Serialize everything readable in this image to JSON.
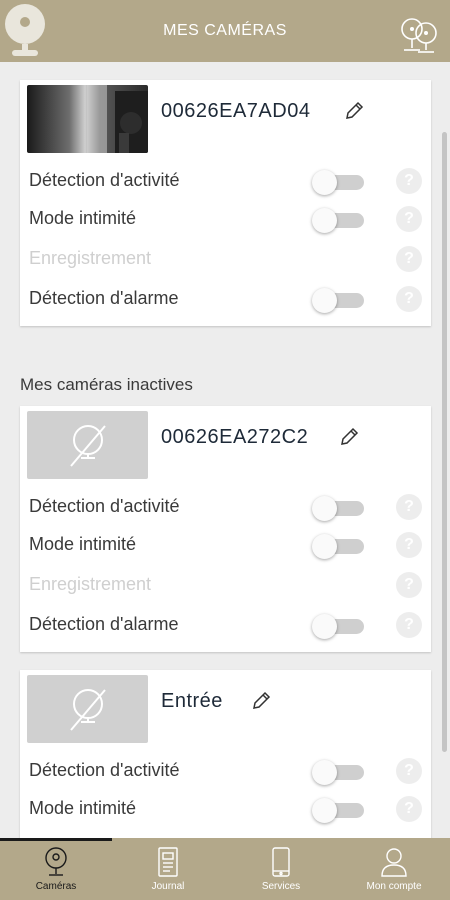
{
  "header": {
    "title": "MES CAMÉRAS"
  },
  "cameras_active": [
    {
      "name": "00626EA7AD04",
      "rows": [
        {
          "label": "Détection d'activité",
          "enabled": true
        },
        {
          "label": "Mode intimité",
          "enabled": true
        },
        {
          "label": "Enregistrement",
          "enabled": false
        },
        {
          "label": "Détection d'alarme",
          "enabled": true
        }
      ]
    }
  ],
  "inactive_section_title": "Mes caméras inactives",
  "cameras_inactive": [
    {
      "name": "00626EA272C2",
      "rows": [
        {
          "label": "Détection d'activité",
          "enabled": true
        },
        {
          "label": "Mode intimité",
          "enabled": true
        },
        {
          "label": "Enregistrement",
          "enabled": false
        },
        {
          "label": "Détection d'alarme",
          "enabled": true
        }
      ]
    },
    {
      "name": "Entrée",
      "rows": [
        {
          "label": "Détection d'activité",
          "enabled": true
        },
        {
          "label": "Mode intimité",
          "enabled": true
        }
      ]
    }
  ],
  "help_glyph": "?",
  "tabs": [
    {
      "label": "Caméras",
      "icon": "camera-icon",
      "active": true
    },
    {
      "label": "Journal",
      "icon": "journal-icon",
      "active": false
    },
    {
      "label": "Services",
      "icon": "phone-icon",
      "active": false
    },
    {
      "label": "Mon compte",
      "icon": "user-icon",
      "active": false
    }
  ],
  "colors": {
    "brand": "#b3a88a",
    "background": "#ededed",
    "text_dark": "#1e2a38"
  }
}
